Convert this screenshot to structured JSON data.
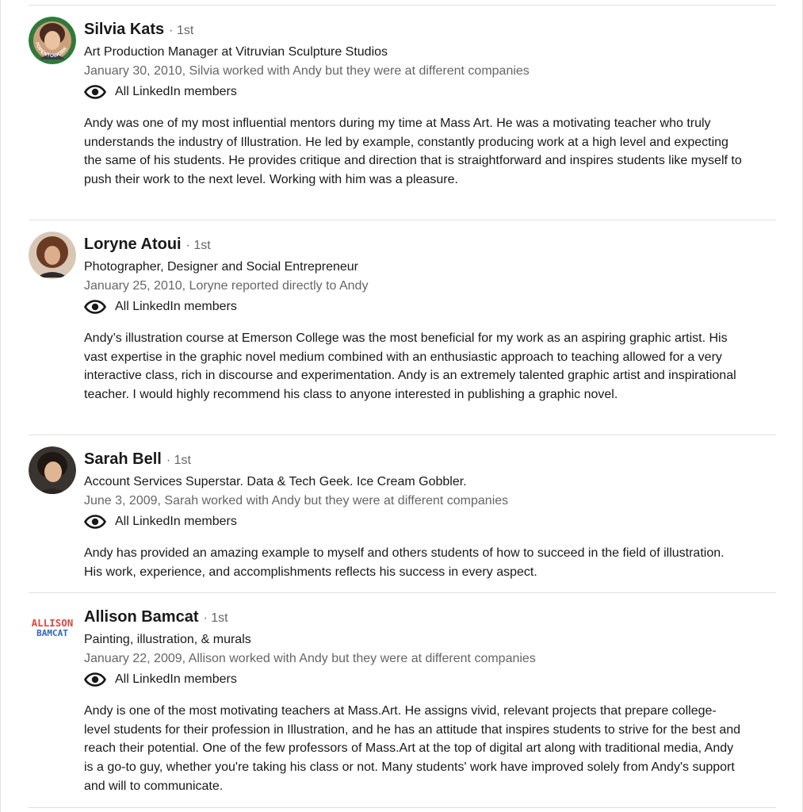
{
  "visibility_icon": "eye-icon",
  "recommendations": [
    {
      "name": "Silvia Kats",
      "degree": "· 1st",
      "headline": "Art Production Manager at Vitruvian Sculpture Studios",
      "meta": "January 30, 2010, Silvia worked with Andy but they were at different companies",
      "visibility": "All LinkedIn members",
      "text": "Andy was one of my most influential mentors during my time at Mass Art. He was a motivating teacher who truly understands the industry of Illustration. He led by example, constantly producing work at a high level and expecting the same of his students. He provides critique and direction that is straightforward and inspires students like myself to push their work to the next level. Working with him was a pleasure.",
      "avatar_badge": "#OPENTOWORK",
      "badge_color": "#2f7a3a"
    },
    {
      "name": "Loryne Atoui",
      "degree": "· 1st",
      "headline": "Photographer, Designer and Social Entrepreneur",
      "meta": "January 25, 2010, Loryne reported directly to Andy",
      "visibility": "All LinkedIn members",
      "text": "Andy’s illustration course at Emerson College was the most beneficial for my work as an aspiring graphic artist. His vast expertise in the graphic novel medium combined with an enthusiastic approach to teaching allowed for a very interactive class, rich in discourse and experimentation. Andy is an extremely talented graphic artist and inspirational teacher. I would highly recommend his class to anyone interested in publishing a graphic novel."
    },
    {
      "name": "Sarah Bell",
      "degree": "· 1st",
      "headline": "Account Services Superstar. Data & Tech Geek. Ice Cream Gobbler.",
      "meta": "June 3, 2009, Sarah worked with Andy but they were at different companies",
      "visibility": "All LinkedIn members",
      "text": "Andy has provided an amazing example to myself and others students of how to succeed in the field of illustration. His work, experience, and accomplishments reflects his success in every aspect."
    },
    {
      "name": "Allison Bamcat",
      "degree": "· 1st",
      "headline": "Painting, illustration, & murals",
      "meta": "January 22, 2009, Allison worked with Andy but they were at different companies",
      "visibility": "All LinkedIn members",
      "text": "Andy is one of the most motivating teachers at Mass.Art. He assigns vivid, relevant projects that prepare college-level students for their profession in Illustration, and he has an attitude that inspires students to strive for the best and reach their potential. One of the few professors of Mass.Art at the top of digital art along with traditional media, Andy is a go-to guy, whether you're taking his class or not. Many students' work have improved solely from Andy's support and will to communicate.",
      "logo_line1": "ALLISON",
      "logo_line2": "BAMCAT"
    }
  ]
}
